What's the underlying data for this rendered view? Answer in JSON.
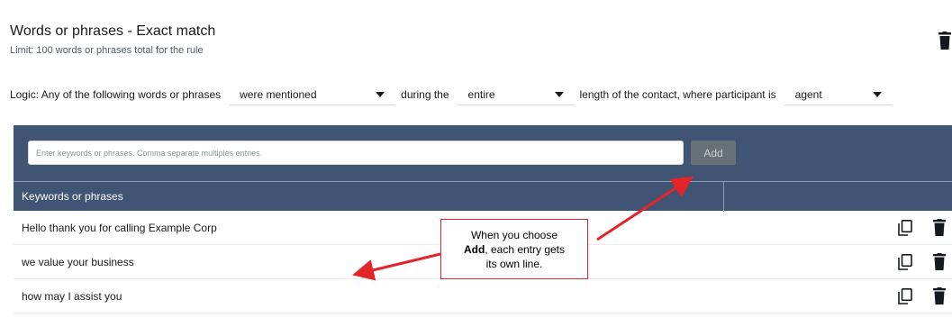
{
  "header": {
    "title": "Words or phrases - Exact match",
    "subtitle": "Limit: 100 words or phrases total for the rule",
    "delete_icon": "trash-icon"
  },
  "logic": {
    "prefix": "Logic: Any of the following words or phrases",
    "mention_select": "were mentioned",
    "during_text": "during the",
    "range_select": "entire",
    "length_text": "length of the contact, where participant is",
    "participant_select": "agent"
  },
  "keywords": {
    "input_placeholder": "Enter keywords or phrases. Comma separate multiples entries.",
    "input_value": "",
    "add_label": "Add",
    "column_header": "Keywords or phrases",
    "rows": [
      {
        "text": "Hello thank you for calling Example Corp",
        "copy_icon": "copy-icon",
        "delete_icon": "trash-icon"
      },
      {
        "text": "we value your business",
        "copy_icon": "copy-icon",
        "delete_icon": "trash-icon"
      },
      {
        "text": "how may I assist you",
        "copy_icon": "copy-icon",
        "delete_icon": "trash-icon"
      }
    ]
  },
  "callout": {
    "line1": "When you choose",
    "bold": "Add",
    "line2_rest": ", each entry gets",
    "line3": "its own line."
  },
  "colors": {
    "panel": "#3f5573",
    "annotation_red": "#e3242b",
    "add_button": "#687078"
  }
}
